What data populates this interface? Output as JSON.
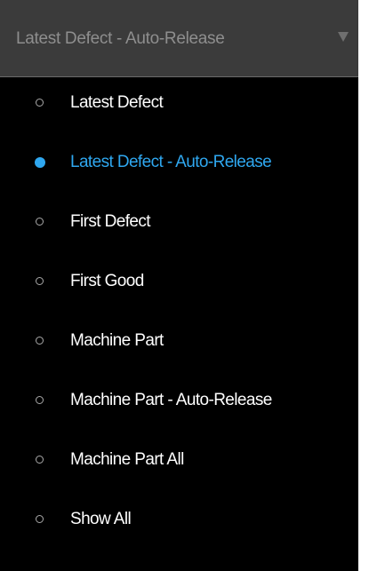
{
  "dropdown": {
    "selected_value": "Latest Defect - Auto-Release",
    "caret_icon": "caret-down-icon"
  },
  "options": [
    {
      "label": "Latest Defect",
      "selected": false
    },
    {
      "label": "Latest Defect - Auto-Release",
      "selected": true
    },
    {
      "label": "First Defect",
      "selected": false
    },
    {
      "label": "First Good",
      "selected": false
    },
    {
      "label": "Machine Part",
      "selected": false
    },
    {
      "label": "Machine Part - Auto-Release",
      "selected": false
    },
    {
      "label": "Machine Part All",
      "selected": false
    },
    {
      "label": "Show All",
      "selected": false
    }
  ],
  "colors": {
    "accent": "#2fa7ef",
    "header_bg": "#3b3b3b",
    "panel_bg": "#000000",
    "option_text": "#ffffff",
    "header_text": "#8e8e8e"
  }
}
